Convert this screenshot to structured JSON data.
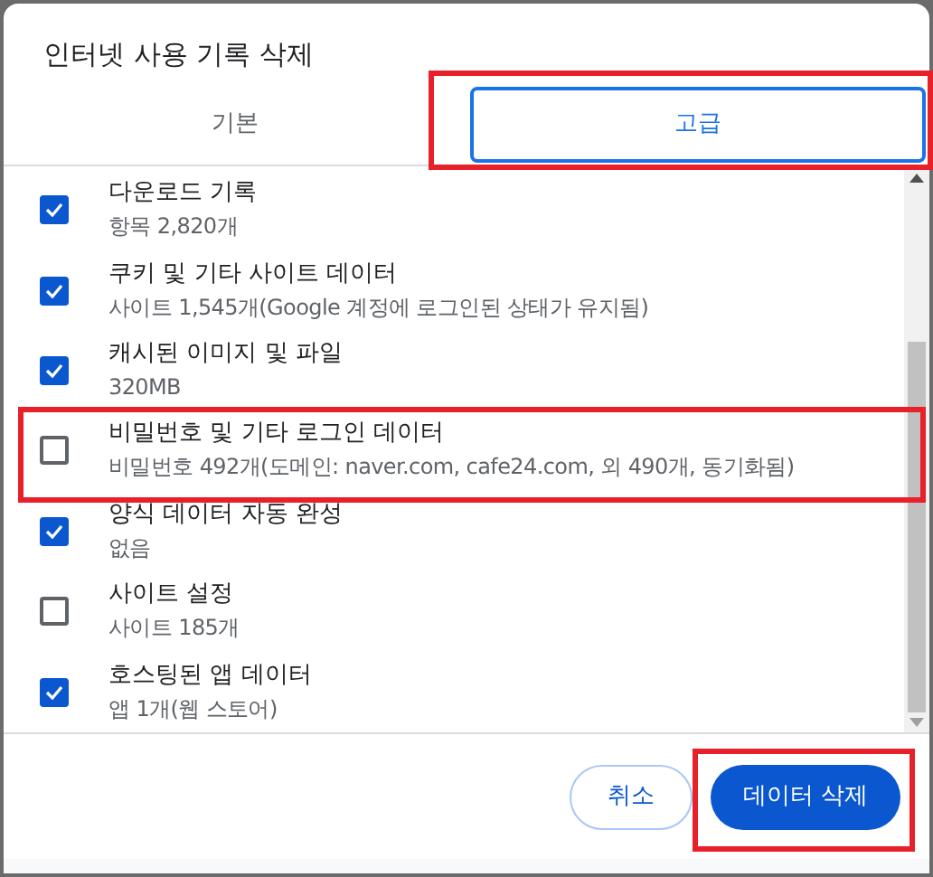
{
  "dialog": {
    "title": "인터넷 사용 기록 삭제"
  },
  "tabs": [
    {
      "label": "기본",
      "selected": false,
      "highlighted": false
    },
    {
      "label": "고급",
      "selected": true,
      "highlighted": true
    }
  ],
  "items": [
    {
      "title": "다운로드 기록",
      "detail": "항목 2,820개",
      "checked": true,
      "highlighted": false
    },
    {
      "title": "쿠키 및 기타 사이트 데이터",
      "detail": "사이트 1,545개(Google 계정에 로그인된 상태가 유지됨)",
      "checked": true,
      "highlighted": false
    },
    {
      "title": "캐시된 이미지 및 파일",
      "detail": "320MB",
      "checked": true,
      "highlighted": false
    },
    {
      "title": "비밀번호 및 기타 로그인 데이터",
      "detail": "비밀번호 492개(도메인: naver.com, cafe24.com, 외 490개, 동기화됨)",
      "checked": false,
      "highlighted": true
    },
    {
      "title": "양식 데이터 자동 완성",
      "detail": "없음",
      "checked": true,
      "highlighted": false
    },
    {
      "title": "사이트 설정",
      "detail": "사이트 185개",
      "checked": false,
      "highlighted": false
    },
    {
      "title": "호스팅된 앱 데이터",
      "detail": "앱 1개(웹 스토어)",
      "checked": true,
      "highlighted": false
    }
  ],
  "buttons": [
    {
      "label": "취소",
      "kind": "secondary",
      "highlighted": false
    },
    {
      "label": "데이터 삭제",
      "kind": "primary",
      "highlighted": true
    }
  ]
}
